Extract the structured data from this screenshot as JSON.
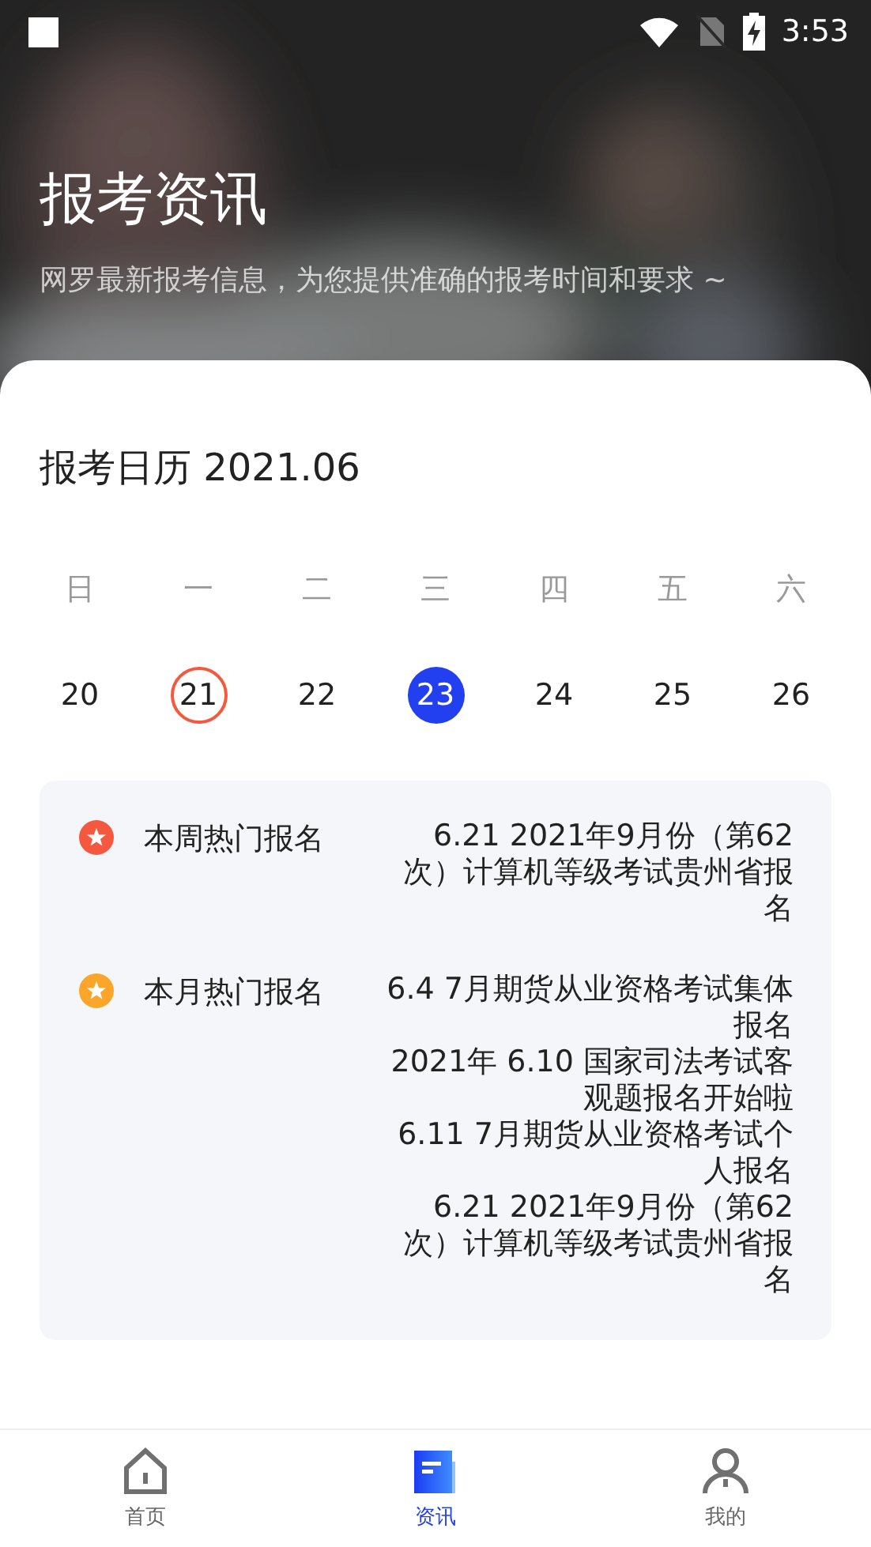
{
  "status_bar": {
    "time": "3:53"
  },
  "header": {
    "title": "报考资讯",
    "subtitle": "网罗最新报考信息，为您提供准确的报考时间和要求 ~"
  },
  "calendar": {
    "title": "报考日历 2021.06",
    "weekdays": [
      "日",
      "一",
      "二",
      "三",
      "四",
      "五",
      "六"
    ],
    "days": [
      {
        "label": "20",
        "today": false,
        "selected": false
      },
      {
        "label": "21",
        "today": true,
        "selected": false
      },
      {
        "label": "22",
        "today": false,
        "selected": false
      },
      {
        "label": "23",
        "today": false,
        "selected": true
      },
      {
        "label": "24",
        "today": false,
        "selected": false
      },
      {
        "label": "25",
        "today": false,
        "selected": false
      },
      {
        "label": "26",
        "today": false,
        "selected": false
      }
    ]
  },
  "hot": [
    {
      "label": "本周热门报名",
      "color": "#f4583f",
      "items": [
        "6.21 2021年9月份（第62次）计算机等级考试贵州省报名"
      ]
    },
    {
      "label": "本月热门报名",
      "color": "#fba62a",
      "items": [
        "6.4 7月期货从业资格考试集体报名",
        "2021年 6.10 国家司法考试客观题报名开始啦",
        "6.11 7月期货从业资格考试个人报名",
        "6.21 2021年9月份（第62次）计算机等级考试贵州省报名"
      ]
    }
  ],
  "nav": [
    {
      "label": "首页",
      "kind": "home",
      "selected": false
    },
    {
      "label": "资讯",
      "kind": "news",
      "selected": true
    },
    {
      "label": "我的",
      "kind": "profile",
      "selected": false
    }
  ]
}
